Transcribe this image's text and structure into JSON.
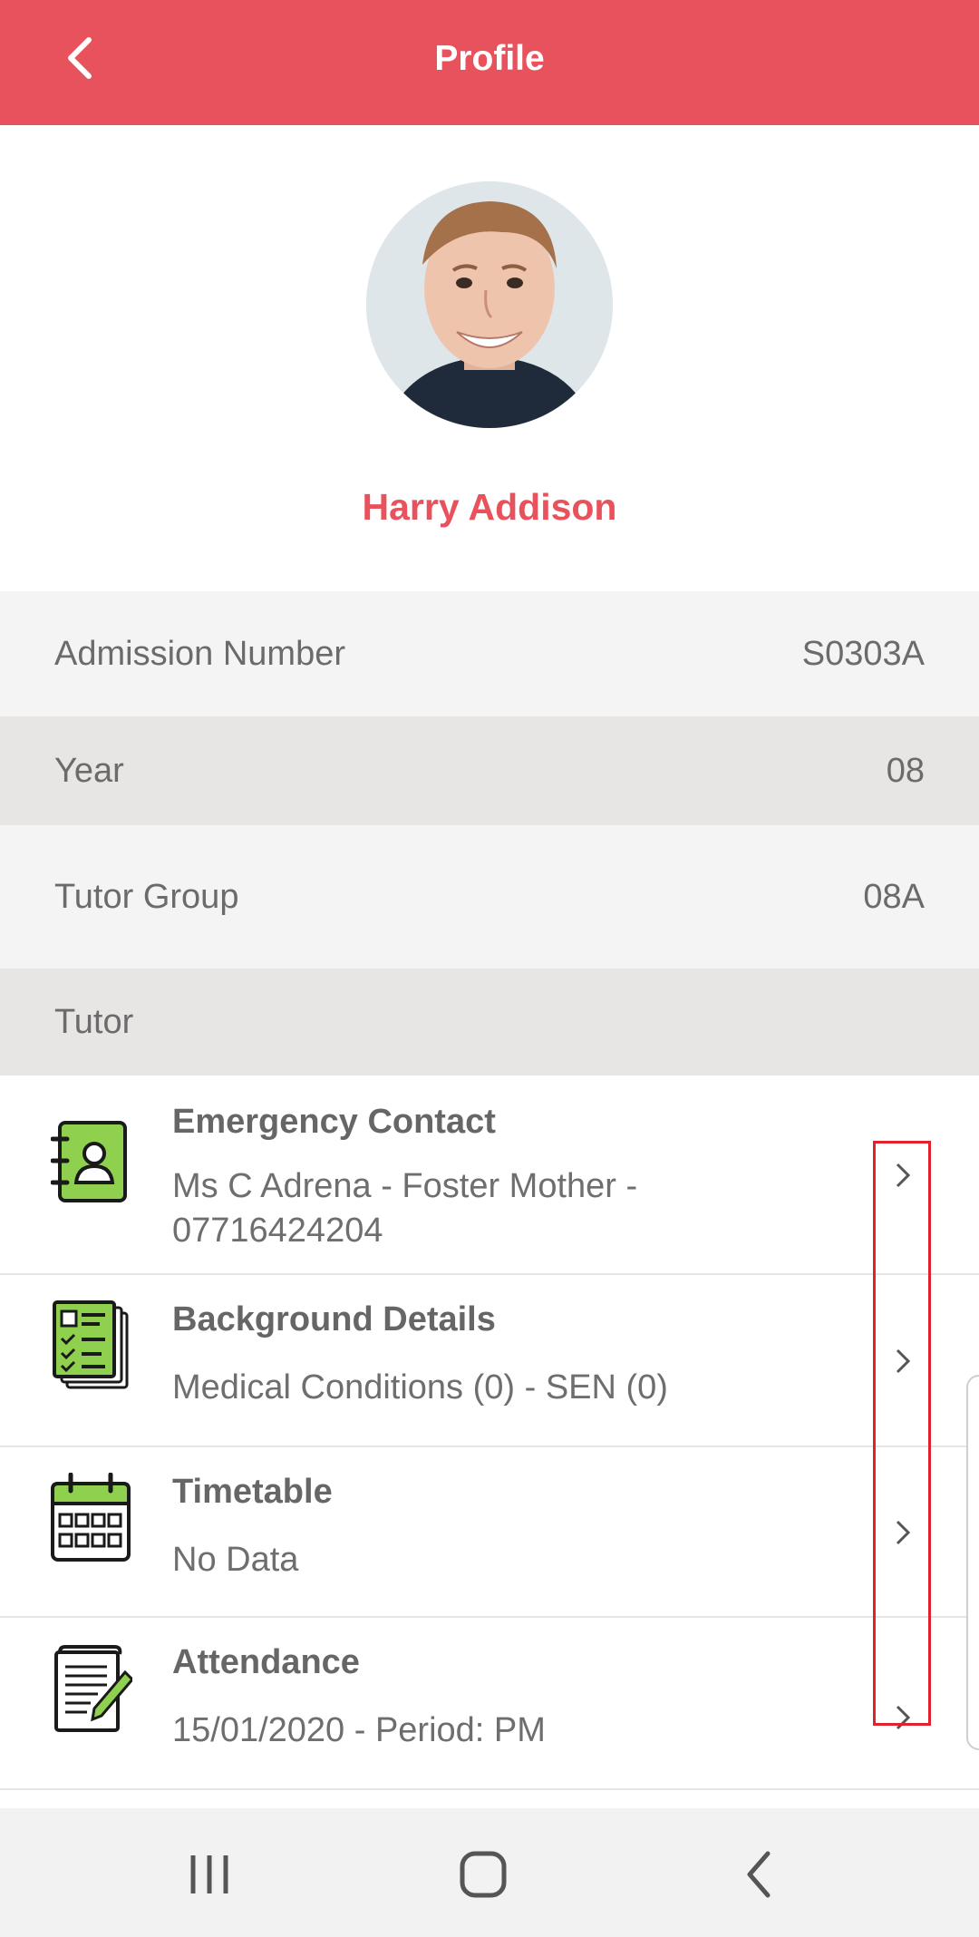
{
  "header": {
    "title": "Profile",
    "back_icon": "chevron-left-icon"
  },
  "student": {
    "name": "Harry Addison",
    "avatar": "student-photo"
  },
  "info": {
    "admission_label": "Admission Number",
    "admission_value": "S0303A",
    "year_label": "Year",
    "year_value": "08",
    "tutor_group_label": "Tutor Group",
    "tutor_group_value": "08A",
    "tutor_label": "Tutor"
  },
  "items": [
    {
      "title": "Emergency Contact",
      "subtitle": "Ms C Adrena - Foster Mother - 07716424204",
      "icon": "contact-book-icon"
    },
    {
      "title": "Background Details",
      "subtitle": "Medical Conditions (0) - SEN (0)",
      "icon": "checklist-document-icon"
    },
    {
      "title": "Timetable",
      "subtitle": "No Data",
      "icon": "calendar-icon"
    },
    {
      "title": "Attendance",
      "subtitle": "15/01/2020 - Period: PM",
      "icon": "register-pencil-icon"
    }
  ],
  "navbar": {
    "recents_icon": "recents-icon",
    "home_icon": "home-icon",
    "back_icon": "back-icon"
  },
  "colors": {
    "brand": "#e8525c",
    "accent_green": "#8fd14f",
    "highlight": "#e3202e"
  }
}
